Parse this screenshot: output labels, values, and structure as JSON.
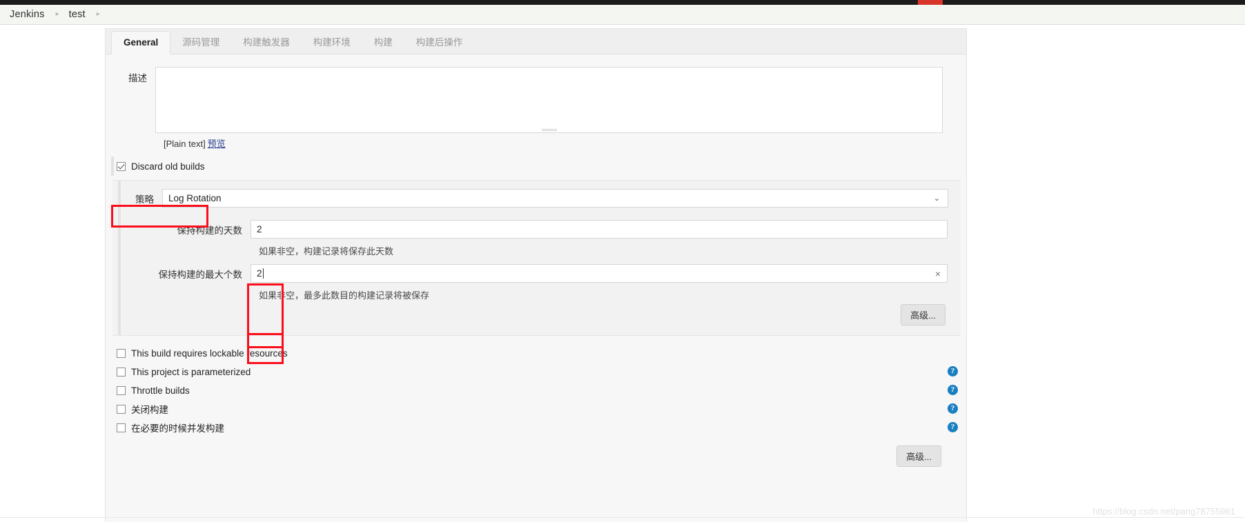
{
  "breadcrumb": {
    "items": [
      "Jenkins",
      "test"
    ],
    "separator": "▸"
  },
  "tabs": [
    {
      "label": "General",
      "active": true
    },
    {
      "label": "源码管理",
      "active": false
    },
    {
      "label": "构建触发器",
      "active": false
    },
    {
      "label": "构建环境",
      "active": false
    },
    {
      "label": "构建",
      "active": false
    },
    {
      "label": "构建后操作",
      "active": false
    }
  ],
  "description": {
    "label": "描述",
    "value": "",
    "placeholder": "",
    "plain_text_note": "[Plain text]",
    "preview_link": "预览"
  },
  "discard_old_builds": {
    "label": "Discard old builds",
    "checked": true,
    "highlighted": true
  },
  "strategy": {
    "label": "策略",
    "selected": "Log Rotation",
    "options": [
      "Log Rotation"
    ],
    "chevron": "⌄"
  },
  "days_to_keep": {
    "label": "保持构建的天数",
    "value": "2",
    "help": "如果非空，构建记录将保存此天数",
    "highlighted": true
  },
  "builds_to_keep": {
    "label": "保持构建的最大个数",
    "value": "2",
    "help": "如果非空，最多此数目的构建记录将被保存",
    "clear_icon": "×",
    "highlighted": true
  },
  "advanced_button_inner": "高级...",
  "advanced_button_outer": "高级...",
  "checkbox_list": [
    {
      "label": "This build requires lockable resources",
      "checked": false,
      "has_help": false
    },
    {
      "label": "This project is parameterized",
      "checked": false,
      "has_help": true
    },
    {
      "label": "Throttle builds",
      "checked": false,
      "has_help": true
    },
    {
      "label": "关闭构建",
      "checked": false,
      "has_help": true
    },
    {
      "label": "在必要的时候并发构建",
      "checked": false,
      "has_help": true
    }
  ],
  "help_icon_glyph": "?",
  "watermark": "https://blog.csdn.net/pang78755961",
  "colors": {
    "annotation_red": "#fc0d1b",
    "help_blue": "#1a7fc1",
    "link_blue": "#2a3f8f",
    "panel_bg": "#f7f7f7",
    "nested_bg": "#f2f2f2"
  }
}
